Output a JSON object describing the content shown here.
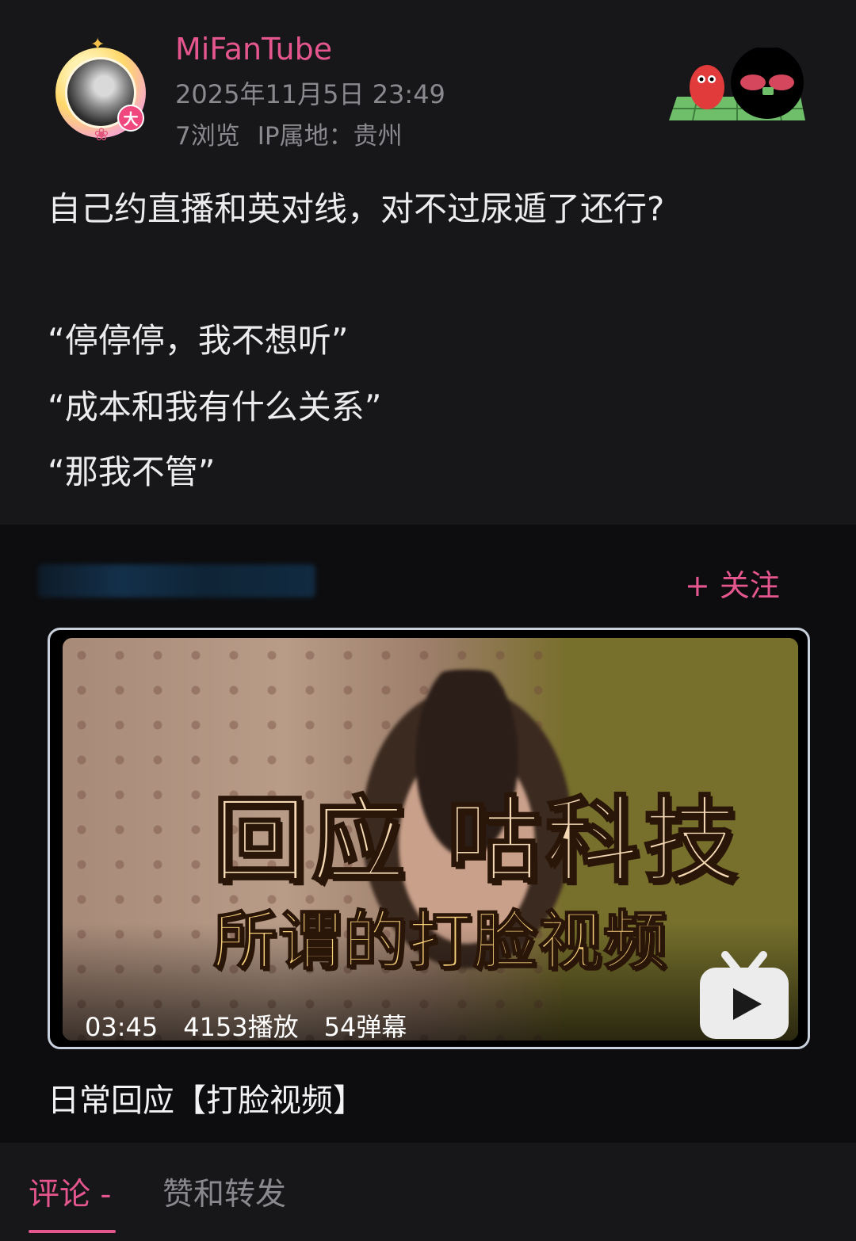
{
  "author": {
    "name": "MiFanTube",
    "avatar_badge": "大",
    "post_time": "2025年11月5日 23:49",
    "views": "7浏览",
    "ip_location": "IP属地：贵州"
  },
  "post": {
    "lines": [
      "自己约直播和英对线，对不过尿遁了还行?",
      "“停停停，我不想听”",
      "“成本和我有什么关系”",
      "“那我不管”"
    ]
  },
  "share_card": {
    "follow_label": "+ 关注",
    "thumbnail_text_1": "回应 咕科技",
    "thumbnail_text_2": "所谓的打脸视频",
    "duration": "03:45",
    "plays": "4153播放",
    "danmaku": "54弹幕",
    "video_title": "日常回应【打脸视频】"
  },
  "tabs": {
    "comments": "评论 -",
    "likes_reposts": "赞和转发"
  },
  "colors": {
    "accent": "#e5568f",
    "background": "#17171a",
    "card_background": "#0d0d0f",
    "muted_text": "#8a8a8e"
  },
  "icons": {
    "video_platform": "tv-play-icon",
    "decoration": "sticker-badge-icon"
  }
}
